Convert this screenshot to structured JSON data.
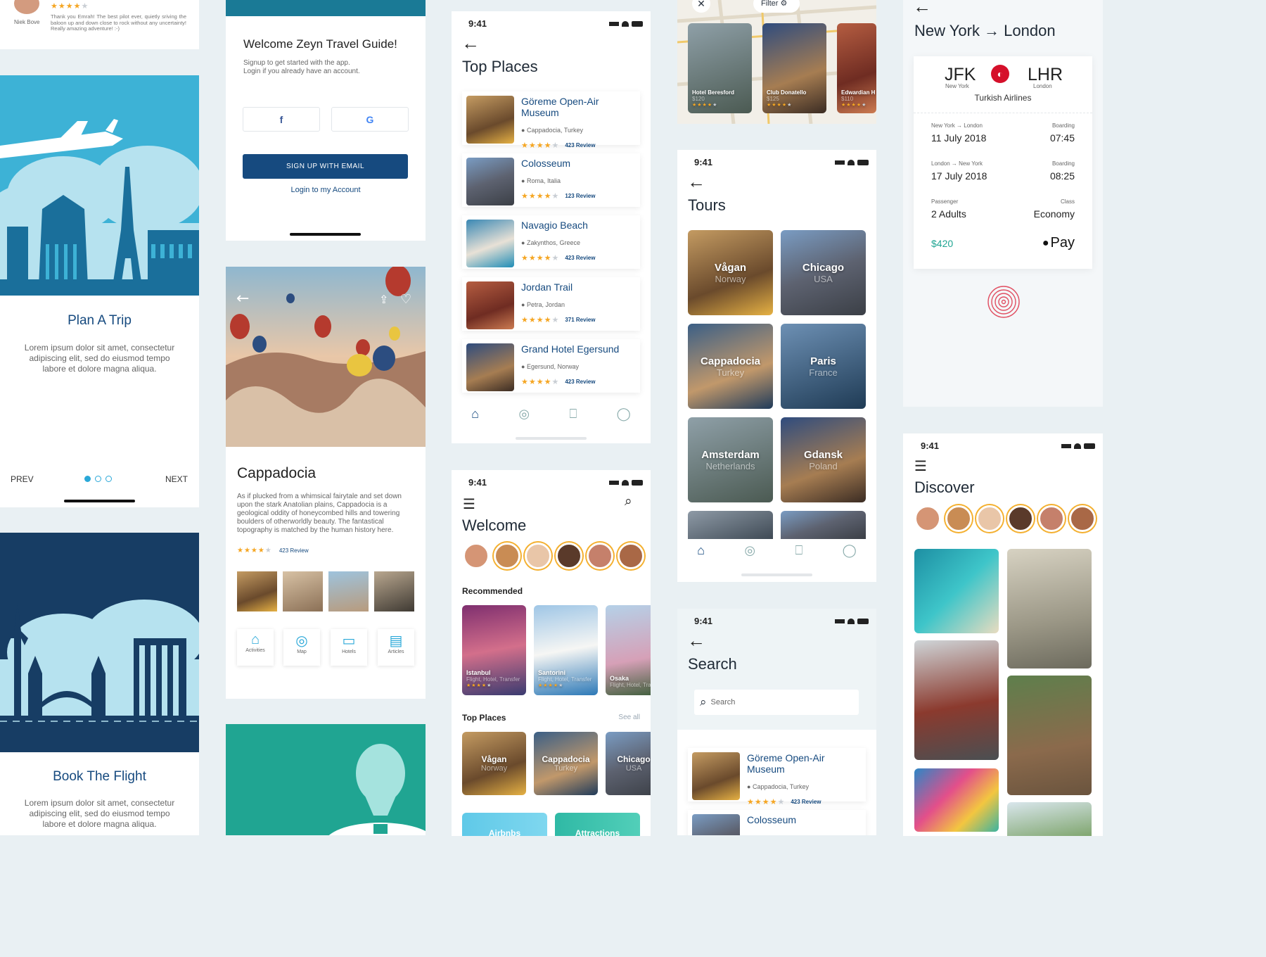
{
  "review": {
    "name": "Niek Bove",
    "text": "Thank you Emrah! The best pilot ever, quietly sriving the baloon up and down close to rock without any uncertainty! Really amazing adventure! :-)"
  },
  "onboard1": {
    "title": "Plan A Trip",
    "body": "Lorem ipsum dolor sit amet, consectetur adipiscing elit, sed do eiusmod tempo labore et dolore magna aliqua.",
    "prev": "PREV",
    "next": "NEXT"
  },
  "onboard2": {
    "title": "Book The Flight",
    "body": "Lorem ipsum dolor sit amet, consectetur adipiscing elit, sed do eiusmod tempo labore et dolore magna aliqua."
  },
  "signup": {
    "title": "Welcome Zeyn Travel Guide!",
    "line1": "Signup to get started with the app.",
    "line2": "Login if you already have an account.",
    "facebook": "f",
    "google": "G",
    "email_btn": "SIGN UP WITH EMAIL",
    "login": "Login to my Account"
  },
  "detail": {
    "title": "Cappadocia",
    "body": "As if plucked from a whimsical fairytale and set down upon the stark Anatolian plains, Cappadocia is a geological oddity of honeycombed hills and towering boulders of otherworldly beauty. The fantastical topography is matched by the human history here.",
    "reviews": "423 Review",
    "cats": [
      "Activities",
      "Map",
      "Hotels",
      "Articles"
    ]
  },
  "time": "9:41",
  "top_places": {
    "title": "Top Places",
    "items": [
      {
        "name": "Göreme Open-Air Museum",
        "loc": "Cappadocia, Turkey",
        "reviews": "423 Review"
      },
      {
        "name": "Colosseum",
        "loc": "Roma, Italia",
        "reviews": "123 Review"
      },
      {
        "name": "Navagio Beach",
        "loc": "Zakynthos, Greece",
        "reviews": "423 Review"
      },
      {
        "name": "Jordan Trail",
        "loc": "Petra, Jordan",
        "reviews": "371 Review"
      },
      {
        "name": "Grand Hotel Egersund",
        "loc": "Egersund, Norway",
        "reviews": "423 Review"
      }
    ]
  },
  "welcome": {
    "title": "Welcome",
    "recommended": "Recommended",
    "top_places": "Top Places",
    "see_all": "See all",
    "rec": [
      {
        "name": "Istanbul",
        "sub": "Flight, Hotel, Transfer"
      },
      {
        "name": "Santorini",
        "sub": "Flight, Hotel, Transfer"
      },
      {
        "name": "Osaka",
        "sub": "Flight, Hotel, Tra"
      }
    ],
    "places": [
      {
        "name": "Vågan",
        "sub": "Norway"
      },
      {
        "name": "Cappadocia",
        "sub": "Turkey"
      },
      {
        "name": "Chicago",
        "sub": "USA"
      }
    ],
    "chips": [
      "Airbnbs",
      "Attractions"
    ]
  },
  "map": {
    "filter": "Filter",
    "hotels": [
      {
        "name": "Hotel Beresford",
        "price": "$120"
      },
      {
        "name": "Club Donatello",
        "price": "$125"
      },
      {
        "name": "Edwardian H",
        "price": "$110"
      }
    ]
  },
  "tours": {
    "title": "Tours",
    "items": [
      {
        "name": "Vågan",
        "sub": "Norway"
      },
      {
        "name": "Chicago",
        "sub": "USA"
      },
      {
        "name": "Cappadocia",
        "sub": "Turkey"
      },
      {
        "name": "Paris",
        "sub": "France"
      },
      {
        "name": "Amsterdam",
        "sub": "Netherlands"
      },
      {
        "name": "Gdansk",
        "sub": "Poland"
      }
    ]
  },
  "search": {
    "title": "Search",
    "placeholder": "Search",
    "items": [
      {
        "name": "Göreme Open-Air Museum",
        "loc": "Cappadocia, Turkey",
        "reviews": "423 Review"
      },
      {
        "name": "Colosseum"
      }
    ]
  },
  "flight": {
    "title": "New York → London",
    "from": "JFK",
    "from_city": "New York",
    "to": "LHR",
    "to_city": "London",
    "airline": "Turkish Airlines",
    "out_route": "New York → London",
    "out_date": "11 July 2018",
    "boarding": "Boarding",
    "out_time": "07:45",
    "ret_route": "London → New York",
    "ret_date": "17 July 2018",
    "ret_time": "08:25",
    "passenger": "Passenger",
    "pax": "2 Adults",
    "class": "Class",
    "class_val": "Economy",
    "price": "$420",
    "pay": "Pay"
  },
  "discover": {
    "title": "Discover"
  }
}
